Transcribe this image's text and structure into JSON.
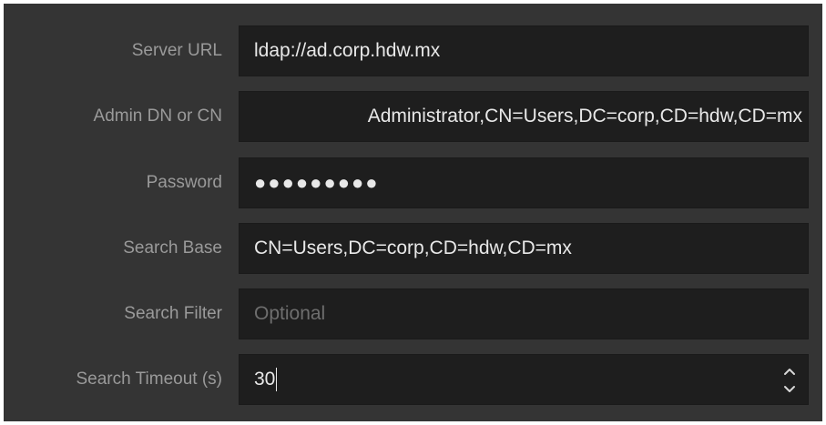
{
  "form": {
    "server_url": {
      "label": "Server URL",
      "value": "ldap://ad.corp.hdw.mx"
    },
    "admin_dn": {
      "label": "Admin DN or CN",
      "value": "Administrator,CN=Users,DC=corp,CD=hdw,CD=mx"
    },
    "password": {
      "label": "Password",
      "masked_value": "●●●●●●●●●"
    },
    "search_base": {
      "label": "Search Base",
      "value": "CN=Users,DC=corp,CD=hdw,CD=mx"
    },
    "search_filter": {
      "label": "Search Filter",
      "value": "",
      "placeholder": "Optional"
    },
    "search_timeout": {
      "label": "Search Timeout (s)",
      "value": "30",
      "increment_icon": "chevron-up-icon",
      "decrement_icon": "chevron-down-icon"
    }
  },
  "colors": {
    "panel_background": "#343434",
    "field_background": "#1e1e1e",
    "label_text": "#9a9a9a",
    "value_text": "#e8e8e8",
    "placeholder_text": "#6e6e6e"
  }
}
